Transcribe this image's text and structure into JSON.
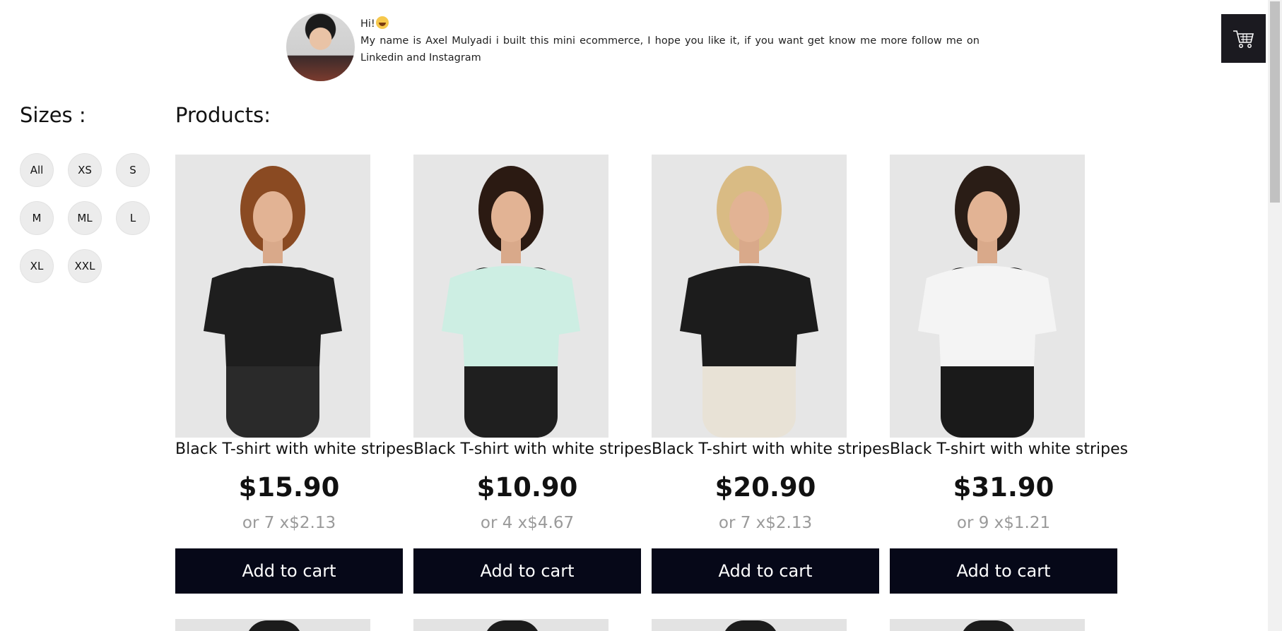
{
  "intro": {
    "greeting": "Hi!",
    "text": "My name is Axel Mulyadi i built this mini ecommerce, I hope you like it, if you want get know me more follow me on Linkedin and Instagram"
  },
  "cart": {
    "icon": "cart-icon"
  },
  "filters": {
    "title": "Sizes :",
    "sizes": [
      "All",
      "XS",
      "S",
      "M",
      "ML",
      "L",
      "XL",
      "XXL"
    ]
  },
  "products": {
    "title": "Products:",
    "items": [
      {
        "name": "Black T-shirt with white stripes",
        "price": "$15.90",
        "installment": "or 7 x$2.13",
        "button": "Add to cart",
        "shirt_color": "#1e1e1e",
        "pants_color": "#2a2a2a",
        "hair_color": "#8a4a22"
      },
      {
        "name": "Black T-shirt with white stripes",
        "price": "$10.90",
        "installment": "or 4 x$4.67",
        "button": "Add to cart",
        "shirt_color": "#cdeee3",
        "pants_color": "#1f1f1f",
        "hair_color": "#2b1a12"
      },
      {
        "name": "Black T-shirt with white stripes",
        "price": "$20.90",
        "installment": "or 7 x$2.13",
        "button": "Add to cart",
        "shirt_color": "#1c1c1c",
        "pants_color": "#e8e2d6",
        "hair_color": "#d9bb84"
      },
      {
        "name": "Black T-shirt with white stripes",
        "price": "$31.90",
        "installment": "or 9 x$1.21",
        "button": "Add to cart",
        "shirt_color": "#f4f4f4",
        "pants_color": "#1a1a1a",
        "hair_color": "#2a1d16"
      }
    ]
  },
  "colors": {
    "button_bg": "#060818",
    "size_bg": "#ececec",
    "muted_text": "#9a9a9a",
    "cart_bg": "#1b1a20"
  }
}
